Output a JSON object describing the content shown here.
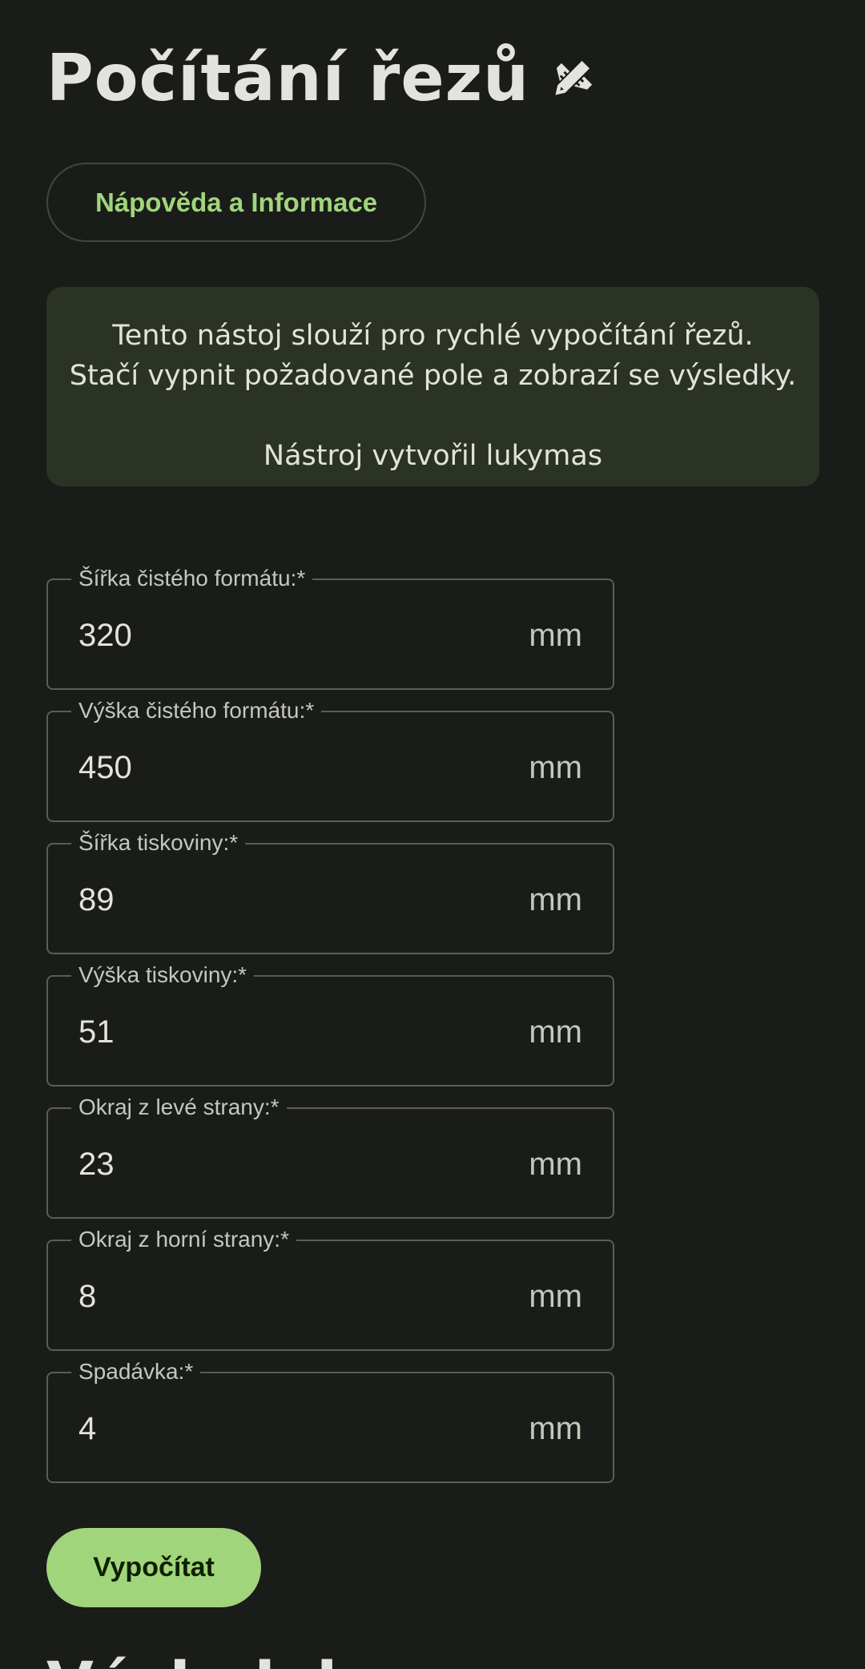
{
  "header": {
    "title": "Počítání řezů",
    "title_icon": "pencil-ruler-icon"
  },
  "help_button": {
    "label": "Nápověda a Informace"
  },
  "info_card": {
    "line1": "Tento nástoj slouží pro rychlé vypočítání řezů.",
    "line2": "Stačí vypnit požadované pole a zobrazí se výsledky.",
    "line3": "Nástroj vytvořil lukymas"
  },
  "form": {
    "fields": [
      {
        "label": "Šířka čistého formátu:*",
        "value": "320",
        "unit": "mm"
      },
      {
        "label": "Výška čistého formátu:*",
        "value": "450",
        "unit": "mm"
      },
      {
        "label": "Šířka tiskoviny:*",
        "value": "89",
        "unit": "mm"
      },
      {
        "label": "Výška tiskoviny:*",
        "value": "51",
        "unit": "mm"
      },
      {
        "label": "Okraj z levé strany:*",
        "value": "23",
        "unit": "mm"
      },
      {
        "label": "Okraj z horní strany:*",
        "value": "8",
        "unit": "mm"
      },
      {
        "label": "Spadávka:*",
        "value": "4",
        "unit": "mm"
      }
    ],
    "submit_label": "Vypočítat"
  },
  "results": {
    "heading": "Výsledek"
  },
  "colors": {
    "background": "#1a1c19",
    "accent": "#a1d57c",
    "card": "#2b3324",
    "outline": "#5a5e55"
  }
}
